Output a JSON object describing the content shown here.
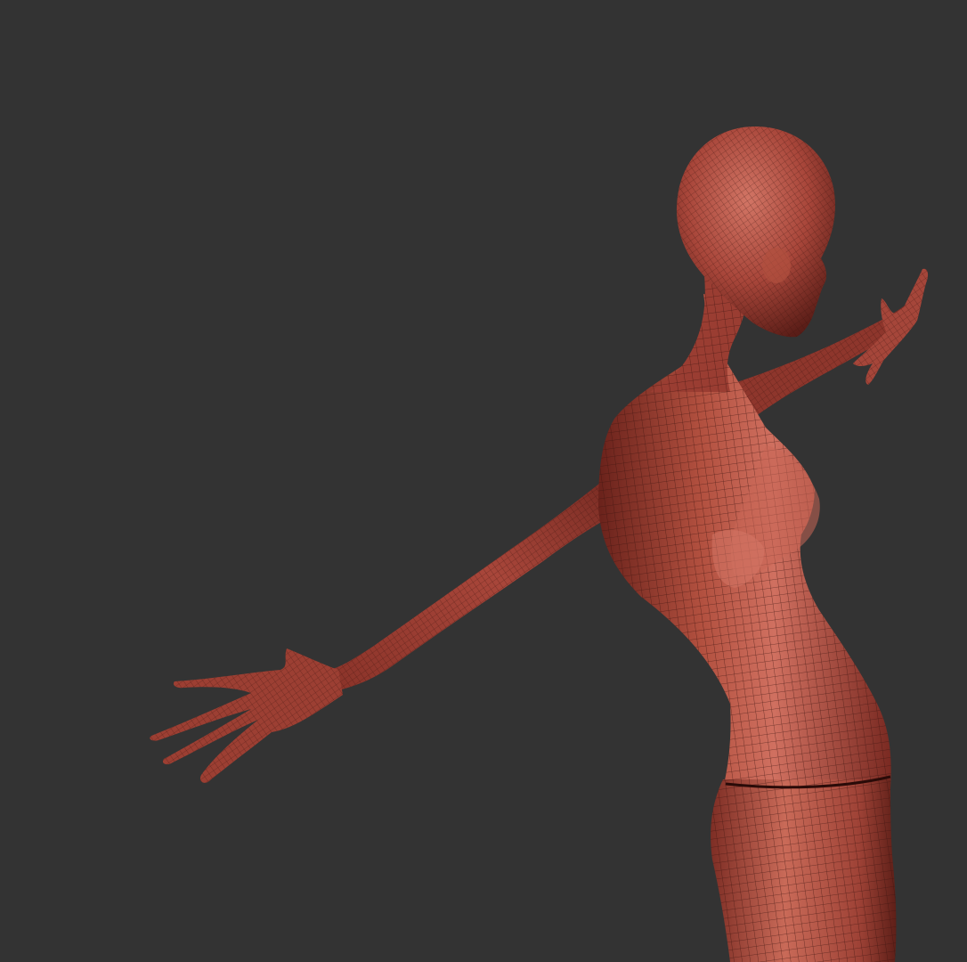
{
  "scene": {
    "background_color": "#333333",
    "model": {
      "kind": "3d-wireframe-human-figure",
      "surface_color": "#a8463a",
      "highlight_color": "#d97a68",
      "shadow_color": "#5a1d17",
      "wire_color": "#3a120e"
    }
  }
}
